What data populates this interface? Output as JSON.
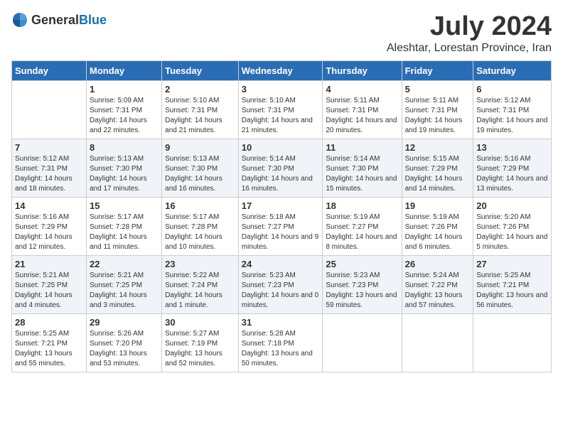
{
  "header": {
    "logo_general": "General",
    "logo_blue": "Blue",
    "title": "July 2024",
    "subtitle": "Aleshtar, Lorestan Province, Iran"
  },
  "days_of_week": [
    "Sunday",
    "Monday",
    "Tuesday",
    "Wednesday",
    "Thursday",
    "Friday",
    "Saturday"
  ],
  "weeks": [
    [
      {
        "day": "",
        "sunrise": "",
        "sunset": "",
        "daylight": ""
      },
      {
        "day": "1",
        "sunrise": "Sunrise: 5:09 AM",
        "sunset": "Sunset: 7:31 PM",
        "daylight": "Daylight: 14 hours and 22 minutes."
      },
      {
        "day": "2",
        "sunrise": "Sunrise: 5:10 AM",
        "sunset": "Sunset: 7:31 PM",
        "daylight": "Daylight: 14 hours and 21 minutes."
      },
      {
        "day": "3",
        "sunrise": "Sunrise: 5:10 AM",
        "sunset": "Sunset: 7:31 PM",
        "daylight": "Daylight: 14 hours and 21 minutes."
      },
      {
        "day": "4",
        "sunrise": "Sunrise: 5:11 AM",
        "sunset": "Sunset: 7:31 PM",
        "daylight": "Daylight: 14 hours and 20 minutes."
      },
      {
        "day": "5",
        "sunrise": "Sunrise: 5:11 AM",
        "sunset": "Sunset: 7:31 PM",
        "daylight": "Daylight: 14 hours and 19 minutes."
      },
      {
        "day": "6",
        "sunrise": "Sunrise: 5:12 AM",
        "sunset": "Sunset: 7:31 PM",
        "daylight": "Daylight: 14 hours and 19 minutes."
      }
    ],
    [
      {
        "day": "7",
        "sunrise": "Sunrise: 5:12 AM",
        "sunset": "Sunset: 7:31 PM",
        "daylight": "Daylight: 14 hours and 18 minutes."
      },
      {
        "day": "8",
        "sunrise": "Sunrise: 5:13 AM",
        "sunset": "Sunset: 7:30 PM",
        "daylight": "Daylight: 14 hours and 17 minutes."
      },
      {
        "day": "9",
        "sunrise": "Sunrise: 5:13 AM",
        "sunset": "Sunset: 7:30 PM",
        "daylight": "Daylight: 14 hours and 16 minutes."
      },
      {
        "day": "10",
        "sunrise": "Sunrise: 5:14 AM",
        "sunset": "Sunset: 7:30 PM",
        "daylight": "Daylight: 14 hours and 16 minutes."
      },
      {
        "day": "11",
        "sunrise": "Sunrise: 5:14 AM",
        "sunset": "Sunset: 7:30 PM",
        "daylight": "Daylight: 14 hours and 15 minutes."
      },
      {
        "day": "12",
        "sunrise": "Sunrise: 5:15 AM",
        "sunset": "Sunset: 7:29 PM",
        "daylight": "Daylight: 14 hours and 14 minutes."
      },
      {
        "day": "13",
        "sunrise": "Sunrise: 5:16 AM",
        "sunset": "Sunset: 7:29 PM",
        "daylight": "Daylight: 14 hours and 13 minutes."
      }
    ],
    [
      {
        "day": "14",
        "sunrise": "Sunrise: 5:16 AM",
        "sunset": "Sunset: 7:29 PM",
        "daylight": "Daylight: 14 hours and 12 minutes."
      },
      {
        "day": "15",
        "sunrise": "Sunrise: 5:17 AM",
        "sunset": "Sunset: 7:28 PM",
        "daylight": "Daylight: 14 hours and 11 minutes."
      },
      {
        "day": "16",
        "sunrise": "Sunrise: 5:17 AM",
        "sunset": "Sunset: 7:28 PM",
        "daylight": "Daylight: 14 hours and 10 minutes."
      },
      {
        "day": "17",
        "sunrise": "Sunrise: 5:18 AM",
        "sunset": "Sunset: 7:27 PM",
        "daylight": "Daylight: 14 hours and 9 minutes."
      },
      {
        "day": "18",
        "sunrise": "Sunrise: 5:19 AM",
        "sunset": "Sunset: 7:27 PM",
        "daylight": "Daylight: 14 hours and 8 minutes."
      },
      {
        "day": "19",
        "sunrise": "Sunrise: 5:19 AM",
        "sunset": "Sunset: 7:26 PM",
        "daylight": "Daylight: 14 hours and 6 minutes."
      },
      {
        "day": "20",
        "sunrise": "Sunrise: 5:20 AM",
        "sunset": "Sunset: 7:26 PM",
        "daylight": "Daylight: 14 hours and 5 minutes."
      }
    ],
    [
      {
        "day": "21",
        "sunrise": "Sunrise: 5:21 AM",
        "sunset": "Sunset: 7:25 PM",
        "daylight": "Daylight: 14 hours and 4 minutes."
      },
      {
        "day": "22",
        "sunrise": "Sunrise: 5:21 AM",
        "sunset": "Sunset: 7:25 PM",
        "daylight": "Daylight: 14 hours and 3 minutes."
      },
      {
        "day": "23",
        "sunrise": "Sunrise: 5:22 AM",
        "sunset": "Sunset: 7:24 PM",
        "daylight": "Daylight: 14 hours and 1 minute."
      },
      {
        "day": "24",
        "sunrise": "Sunrise: 5:23 AM",
        "sunset": "Sunset: 7:23 PM",
        "daylight": "Daylight: 14 hours and 0 minutes."
      },
      {
        "day": "25",
        "sunrise": "Sunrise: 5:23 AM",
        "sunset": "Sunset: 7:23 PM",
        "daylight": "Daylight: 13 hours and 59 minutes."
      },
      {
        "day": "26",
        "sunrise": "Sunrise: 5:24 AM",
        "sunset": "Sunset: 7:22 PM",
        "daylight": "Daylight: 13 hours and 57 minutes."
      },
      {
        "day": "27",
        "sunrise": "Sunrise: 5:25 AM",
        "sunset": "Sunset: 7:21 PM",
        "daylight": "Daylight: 13 hours and 56 minutes."
      }
    ],
    [
      {
        "day": "28",
        "sunrise": "Sunrise: 5:25 AM",
        "sunset": "Sunset: 7:21 PM",
        "daylight": "Daylight: 13 hours and 55 minutes."
      },
      {
        "day": "29",
        "sunrise": "Sunrise: 5:26 AM",
        "sunset": "Sunset: 7:20 PM",
        "daylight": "Daylight: 13 hours and 53 minutes."
      },
      {
        "day": "30",
        "sunrise": "Sunrise: 5:27 AM",
        "sunset": "Sunset: 7:19 PM",
        "daylight": "Daylight: 13 hours and 52 minutes."
      },
      {
        "day": "31",
        "sunrise": "Sunrise: 5:28 AM",
        "sunset": "Sunset: 7:18 PM",
        "daylight": "Daylight: 13 hours and 50 minutes."
      },
      {
        "day": "",
        "sunrise": "",
        "sunset": "",
        "daylight": ""
      },
      {
        "day": "",
        "sunrise": "",
        "sunset": "",
        "daylight": ""
      },
      {
        "day": "",
        "sunrise": "",
        "sunset": "",
        "daylight": ""
      }
    ]
  ]
}
